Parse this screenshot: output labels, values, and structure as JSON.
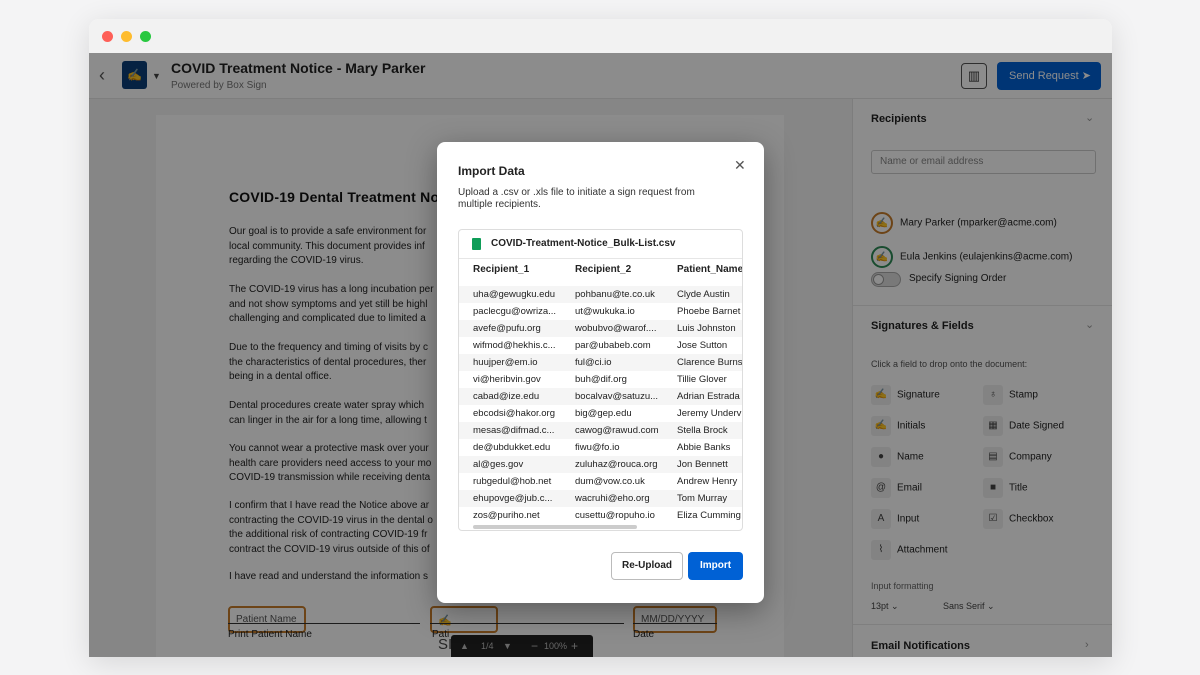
{
  "window": {
    "dots": [
      "#fe5f57",
      "#febc2e",
      "#28c840"
    ]
  },
  "header": {
    "title": "COVID Treatment Notice - Mary Parker",
    "subtitle": "Powered by Box Sign",
    "send_label": "Send Request"
  },
  "document": {
    "heading": "COVID-19 Dental Treatment No",
    "paragraphs": [
      "Our goal is to provide a safe environment for\nlocal community. This document provides inf\nregarding the COVID-19 virus.",
      "The COVID-19 virus has a long incubation per\nand not show symptoms and yet still be highl\nchallenging and complicated due to limited a",
      "Due to the frequency and timing of visits by c\nthe characteristics of dental procedures, ther\nbeing in a dental office.",
      "Dental procedures create water spray which\ncan linger in the air for a long time, allowing t",
      "You cannot wear a protective mask over your\nhealth care providers need access to your mo\nCOVID-19 transmission while receiving denta",
      "I confirm that I have read the Notice above ar\ncontracting the COVID-19 virus in the dental o\nthe additional risk of contracting COVID-19 fr\ncontract the COVID-19 virus outside of this of",
      "I have read and understand the information s"
    ],
    "fields": {
      "patient_name": "Patient Name",
      "sign": "SIGN",
      "date": "MM/DD/YYYY"
    },
    "under_labels": {
      "print": "Print Patient Name",
      "patient": "Pati",
      "date": "Date"
    },
    "pager": {
      "page": "1/4",
      "zoom": "100%"
    }
  },
  "sidebar": {
    "recipients_title": "Recipients",
    "search_placeholder": "Name or email address",
    "recipients": [
      {
        "name": "Mary Parker (mparker@acme.com)",
        "color": "#c77d2a"
      },
      {
        "name": "Eula Jenkins (eulajenkins@acme.com)",
        "color": "#2e8b57"
      }
    ],
    "signing_order_label": "Specify Signing Order",
    "fields_title": "Signatures & Fields",
    "fields_hint": "Click a field to drop onto the document:",
    "fields": {
      "signature": "Signature",
      "stamp": "Stamp",
      "initials": "Initials",
      "date_signed": "Date Signed",
      "name": "Name",
      "company": "Company",
      "email": "Email",
      "title": "Title",
      "input": "Input",
      "checkbox": "Checkbox",
      "attachment": "Attachment"
    },
    "input_formatting_label": "Input formatting",
    "font_size": "13pt",
    "font_family": "Sans Serif",
    "email_notifications_title": "Email Notifications"
  },
  "modal": {
    "title": "Import Data",
    "description": "Upload a .csv or .xls file to initiate a sign request from multiple recipients.",
    "file_name": "COVID-Treatment-Notice_Bulk-List.csv",
    "columns": [
      "Recipient_1",
      "Recipient_2",
      "Patient_Name"
    ],
    "rows": [
      [
        "uha@gewugku.edu",
        "pohbanu@te.co.uk",
        "Clyde Austin"
      ],
      [
        "paclecgu@owriza...",
        "ut@wukuka.io",
        "Phoebe Barnet"
      ],
      [
        "avefe@pufu.org",
        "wobubvo@warof....",
        "Luis Johnston"
      ],
      [
        "wifmod@hekhis.c...",
        "par@ubabeb.com",
        "Jose Sutton"
      ],
      [
        "huujper@em.io",
        "ful@ci.io",
        "Clarence Burns"
      ],
      [
        "vi@heribvin.gov",
        "buh@dif.org",
        "Tillie Glover"
      ],
      [
        "cabad@ize.edu",
        "bocalvav@satuzu...",
        "Adrian Estrada"
      ],
      [
        "ebcodsi@hakor.org",
        "big@gep.edu",
        "Jeremy Underv"
      ],
      [
        "mesas@difmad.c...",
        "cawog@rawud.com",
        "Stella Brock"
      ],
      [
        "de@ubdukket.edu",
        "fiwu@fo.io",
        "Abbie Banks"
      ],
      [
        "al@ges.gov",
        "zuluhaz@rouca.org",
        "Jon Bennett"
      ],
      [
        "rubgedul@hob.net",
        "dum@vow.co.uk",
        "Andrew Henry"
      ],
      [
        "ehupovge@jub.c...",
        "wacruhi@eho.org",
        "Tom Murray"
      ],
      [
        "zos@puriho.net",
        "cusettu@ropuho.io",
        "Eliza Cumming"
      ]
    ],
    "reupload_label": "Re-Upload",
    "import_label": "Import"
  }
}
